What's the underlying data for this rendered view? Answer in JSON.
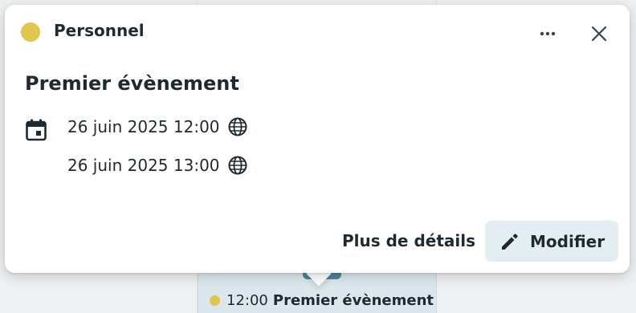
{
  "calendar": {
    "name": "Personnel",
    "color": "#e0c64f"
  },
  "event": {
    "title": "Premier évènement",
    "start": "26 juin 2025 12:00",
    "end": "26 juin 2025 13:00"
  },
  "actions": {
    "details_label": "Plus de détails",
    "edit_label": "Modifier"
  },
  "icons": {
    "more": "more-horizontal-icon",
    "close": "close-icon",
    "date": "calendar-event-icon",
    "timezone": "globe-icon",
    "edit": "pencil-icon"
  },
  "background_event": {
    "time": "12:00",
    "title": "Premier évènement"
  }
}
